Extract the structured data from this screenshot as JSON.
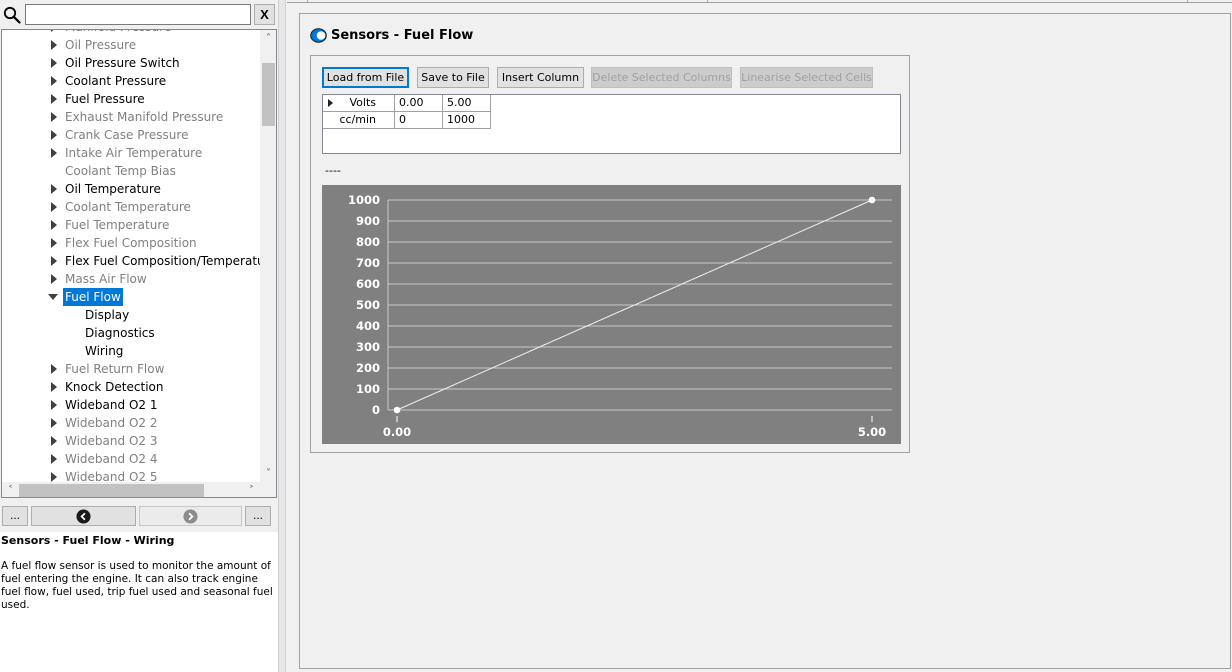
{
  "search": {
    "placeholder": "",
    "value": "",
    "clear_label": "X"
  },
  "tree": {
    "items": [
      {
        "label": "Manifold Pressure",
        "depth": 1,
        "expander": "collapsed",
        "dim": true
      },
      {
        "label": "Oil Pressure",
        "depth": 1,
        "expander": "collapsed",
        "dim": true
      },
      {
        "label": "Oil Pressure Switch",
        "depth": 1,
        "expander": "collapsed",
        "dim": false
      },
      {
        "label": "Coolant Pressure",
        "depth": 1,
        "expander": "collapsed",
        "dim": false
      },
      {
        "label": "Fuel Pressure",
        "depth": 1,
        "expander": "collapsed",
        "dim": false
      },
      {
        "label": "Exhaust Manifold Pressure",
        "depth": 1,
        "expander": "collapsed",
        "dim": true
      },
      {
        "label": "Crank Case Pressure",
        "depth": 1,
        "expander": "collapsed",
        "dim": true
      },
      {
        "label": "Intake Air Temperature",
        "depth": 1,
        "expander": "collapsed",
        "dim": true
      },
      {
        "label": "Coolant Temp Bias",
        "depth": 1,
        "expander": "none",
        "dim": true
      },
      {
        "label": "Oil Temperature",
        "depth": 1,
        "expander": "collapsed",
        "dim": false
      },
      {
        "label": "Coolant Temperature",
        "depth": 1,
        "expander": "collapsed",
        "dim": true
      },
      {
        "label": "Fuel Temperature",
        "depth": 1,
        "expander": "collapsed",
        "dim": true
      },
      {
        "label": "Flex Fuel Composition",
        "depth": 1,
        "expander": "collapsed",
        "dim": true
      },
      {
        "label": "Flex Fuel Composition/Temperature S",
        "depth": 1,
        "expander": "collapsed",
        "dim": false
      },
      {
        "label": "Mass Air Flow",
        "depth": 1,
        "expander": "collapsed",
        "dim": true
      },
      {
        "label": "Fuel Flow",
        "depth": 1,
        "expander": "expanded",
        "dim": false,
        "selected": true
      },
      {
        "label": "Display",
        "depth": 2,
        "expander": "none",
        "dim": false
      },
      {
        "label": "Diagnostics",
        "depth": 2,
        "expander": "none",
        "dim": false
      },
      {
        "label": "Wiring",
        "depth": 2,
        "expander": "none",
        "dim": false
      },
      {
        "label": "Fuel Return Flow",
        "depth": 1,
        "expander": "collapsed",
        "dim": true
      },
      {
        "label": "Knock Detection",
        "depth": 1,
        "expander": "collapsed",
        "dim": false
      },
      {
        "label": "Wideband O2 1",
        "depth": 1,
        "expander": "collapsed",
        "dim": false
      },
      {
        "label": "Wideband O2 2",
        "depth": 1,
        "expander": "collapsed",
        "dim": true
      },
      {
        "label": "Wideband O2 3",
        "depth": 1,
        "expander": "collapsed",
        "dim": true
      },
      {
        "label": "Wideband O2 4",
        "depth": 1,
        "expander": "collapsed",
        "dim": true
      },
      {
        "label": "Wideband O2 5",
        "depth": 1,
        "expander": "collapsed",
        "dim": true
      }
    ]
  },
  "nav": {
    "more_left_label": "...",
    "more_right_label": "..."
  },
  "help": {
    "title": "Sensors - Fuel Flow - Wiring",
    "text": "A fuel flow sensor is used to monitor the amount of fuel entering the engine. It can also track engine fuel flow, fuel used, trip fuel used and seasonal fuel used."
  },
  "page": {
    "title": "Sensors - Fuel Flow"
  },
  "toolbar": {
    "load_label": "Load from File",
    "save_label": "Save to File",
    "insert_label": "Insert Column",
    "delete_label": "Delete Selected Columns",
    "linearise_label": "Linearise Selected Cells"
  },
  "table": {
    "rows": [
      {
        "header": "Volts",
        "cells": [
          "0.00",
          "5.00"
        ]
      },
      {
        "header": "cc/min",
        "cells": [
          "0",
          "1000"
        ]
      }
    ]
  },
  "status_text": "----",
  "colors": {
    "accent": "#0078d7",
    "chart_bg": "#808080",
    "chart_line": "#ffffff"
  },
  "chart_data": {
    "type": "line",
    "x": [
      0.0,
      5.0
    ],
    "series": [
      {
        "values": [
          0,
          1000
        ]
      }
    ],
    "x_tick_labels": [
      "0.00",
      "5.00"
    ],
    "y_tick_labels": [
      "0",
      "100",
      "200",
      "300",
      "400",
      "500",
      "600",
      "700",
      "800",
      "900",
      "1000"
    ],
    "xlim": [
      0.0,
      5.0
    ],
    "ylim": [
      0,
      1000
    ],
    "grid": true
  }
}
